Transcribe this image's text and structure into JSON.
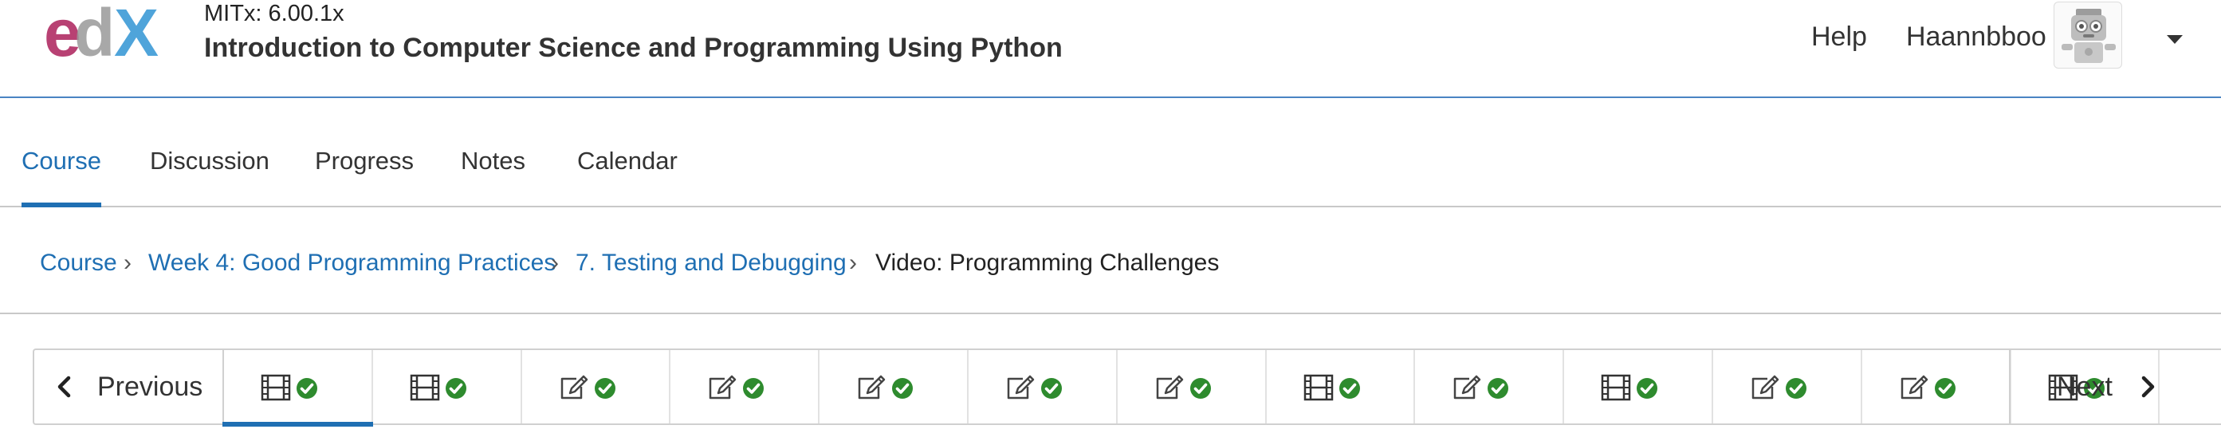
{
  "header": {
    "logo_text": "edX",
    "course_org": "MITx: 6.00.1x",
    "course_title": "Introduction to Computer Science and Programming Using Python",
    "help_label": "Help",
    "username": "Haannbboo",
    "colors": {
      "brand_blue": "#1f6fb3",
      "logo_pink": "#b12d64",
      "logo_gray": "#9a9a9a",
      "logo_blue": "#3d9bd7"
    }
  },
  "tabs": [
    {
      "label": "Course",
      "active": true
    },
    {
      "label": "Discussion",
      "active": false
    },
    {
      "label": "Progress",
      "active": false
    },
    {
      "label": "Notes",
      "active": false
    },
    {
      "label": "Calendar",
      "active": false
    }
  ],
  "breadcrumb": {
    "items": [
      "Course",
      "Week 4: Good Programming Practices",
      "7. Testing and Debugging",
      "Video: Programming Challenges"
    ],
    "separator": "›"
  },
  "sequence": {
    "previous_label": "Previous",
    "next_label": "Next",
    "units": [
      {
        "icon": "video-icon",
        "completed": true,
        "active": true
      },
      {
        "icon": "video-icon",
        "completed": true,
        "active": false
      },
      {
        "icon": "problem-icon",
        "completed": true,
        "active": false
      },
      {
        "icon": "problem-icon",
        "completed": true,
        "active": false
      },
      {
        "icon": "problem-icon",
        "completed": true,
        "active": false
      },
      {
        "icon": "problem-icon",
        "completed": true,
        "active": false
      },
      {
        "icon": "problem-icon",
        "completed": true,
        "active": false
      },
      {
        "icon": "video-icon",
        "completed": true,
        "active": false
      },
      {
        "icon": "problem-icon",
        "completed": true,
        "active": false
      },
      {
        "icon": "video-icon",
        "completed": true,
        "active": false
      },
      {
        "icon": "problem-icon",
        "completed": true,
        "active": false
      },
      {
        "icon": "problem-icon",
        "completed": true,
        "active": false
      },
      {
        "icon": "video-icon",
        "completed": true,
        "active": false
      }
    ],
    "colors": {
      "check_green": "#2e8b2e",
      "active_underline": "#1f6fb3"
    }
  }
}
